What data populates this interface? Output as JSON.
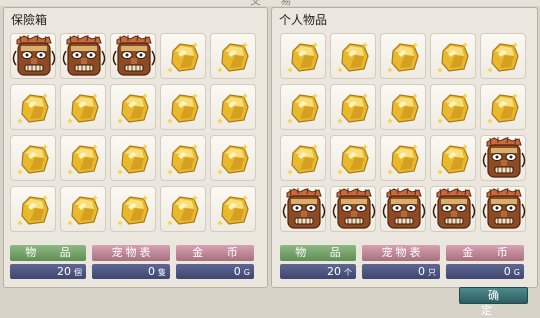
{
  "window": {
    "title": "交 易"
  },
  "left_panel": {
    "title": "保險箱",
    "slots": [
      "mask",
      "mask",
      "mask",
      "ore",
      "ore",
      "ore",
      "ore",
      "ore",
      "ore",
      "ore",
      "ore",
      "ore",
      "ore",
      "ore",
      "ore",
      "ore",
      "ore",
      "ore",
      "ore",
      "ore"
    ],
    "tabs": {
      "items": "物 品",
      "pets": "宠物表",
      "coins": "金 币"
    },
    "values": {
      "items": "20",
      "items_unit": "個",
      "pets": "0",
      "pets_unit": "隻",
      "coins": "0",
      "coins_unit": "G"
    }
  },
  "right_panel": {
    "title": "个人物品",
    "slots": [
      "ore",
      "ore",
      "ore",
      "ore",
      "ore",
      "ore",
      "ore",
      "ore",
      "ore",
      "ore",
      "ore",
      "ore",
      "ore",
      "ore",
      "mask",
      "mask",
      "mask",
      "mask",
      "mask",
      "mask"
    ],
    "tabs": {
      "items": "物 品",
      "pets": "宠物表",
      "coins": "金 币"
    },
    "values": {
      "items": "20",
      "items_unit": "个",
      "pets": "0",
      "pets_unit": "只",
      "coins": "0",
      "coins_unit": "G"
    }
  },
  "confirm_label": "确 定",
  "item_icons": {
    "mask": "tiki-mask-icon",
    "ore": "gold-ore-icon"
  },
  "colors": {
    "tab_items": "#6f9c63",
    "tab_pets": "#b98292",
    "value_bg": "#4a5280",
    "confirm_bg": "#3b7174"
  }
}
